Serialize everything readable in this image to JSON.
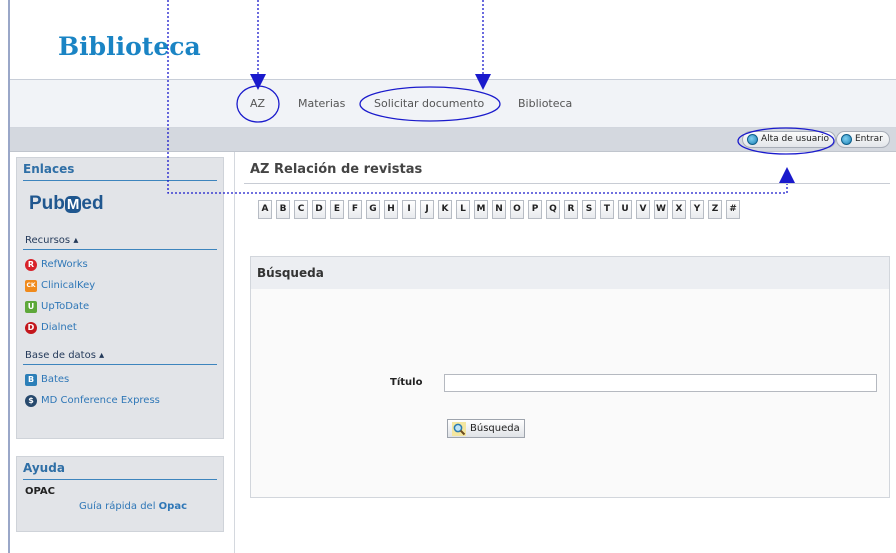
{
  "header": {
    "logo": "Biblioteca"
  },
  "nav": {
    "items": [
      {
        "label": "AZ"
      },
      {
        "label": "Materias"
      },
      {
        "label": "Solicitar documento"
      },
      {
        "label": "Biblioteca"
      }
    ]
  },
  "toolbar": {
    "signup_label": "Alta de usuario",
    "login_label": "Entrar"
  },
  "sidebar": {
    "links_title": "Enlaces",
    "pubmed": {
      "prefix": "Pub",
      "m": "M",
      "suffix": "ed"
    },
    "resources_title": "Recursos ▴",
    "resources": [
      {
        "label": "RefWorks",
        "icon": "refworks-icon",
        "color": "#d8222a",
        "glyph": "R"
      },
      {
        "label": "ClinicalKey",
        "icon": "clinicalkey-icon",
        "color": "#f08a1c",
        "glyph": "CK"
      },
      {
        "label": "UpToDate",
        "icon": "uptodate-icon",
        "color": "#5ea83a",
        "glyph": "U"
      },
      {
        "label": "Dialnet",
        "icon": "dialnet-icon",
        "color": "#c3161c",
        "glyph": "D"
      }
    ],
    "databases_title": "Base de datos ▴",
    "databases": [
      {
        "label": "Bates",
        "icon": "bates-icon",
        "color": "#2c7fb8",
        "glyph": "B"
      },
      {
        "label": "MD Conference Express",
        "icon": "md-conference-icon",
        "color": "#27496d",
        "glyph": "$"
      }
    ],
    "help_title": "Ayuda",
    "opac_label": "OPAC",
    "opac_guide_prefix": "Guía rápida del ",
    "opac_guide_bold": "Opac"
  },
  "main": {
    "title": "AZ Relación de revistas",
    "letters": [
      "A",
      "B",
      "C",
      "D",
      "E",
      "F",
      "G",
      "H",
      "I",
      "J",
      "K",
      "L",
      "M",
      "N",
      "O",
      "P",
      "Q",
      "R",
      "S",
      "T",
      "U",
      "V",
      "W",
      "X",
      "Y",
      "Z",
      "#"
    ],
    "search": {
      "title": "Búsqueda",
      "field_label": "Título",
      "field_value": "",
      "button_label": "Búsqueda"
    }
  },
  "colors": {
    "accent": "#1a84c4",
    "link": "#2f77b7",
    "annotation": "#1a1acc"
  }
}
